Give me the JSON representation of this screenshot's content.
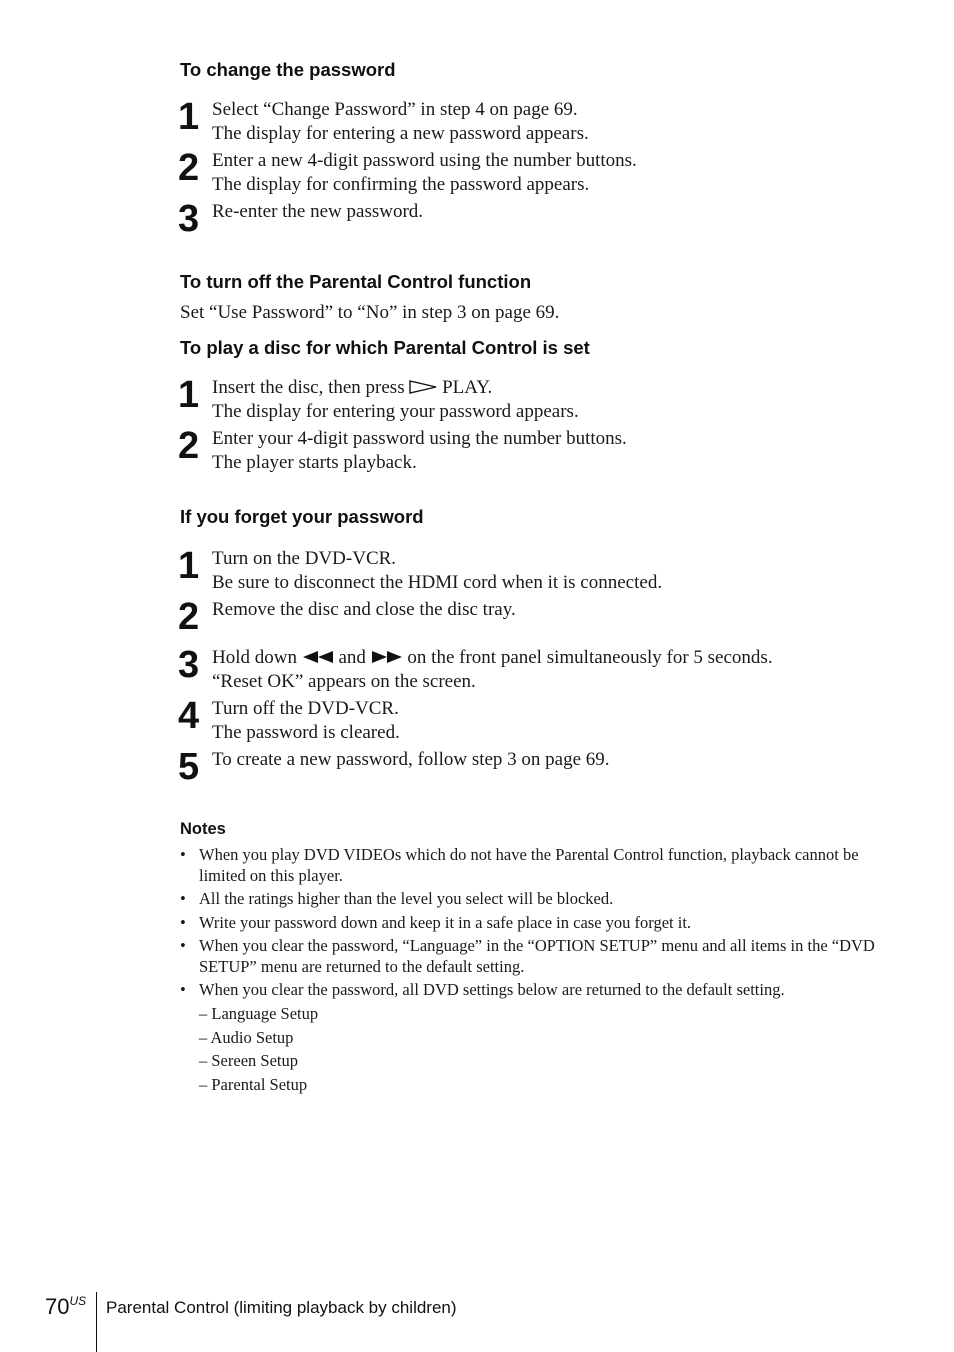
{
  "section_change": {
    "heading": "To change the password",
    "steps": [
      {
        "num": "1",
        "line1": "Select “Change Password” in step 4 on page 69.",
        "line2": "The display for entering a new password appears."
      },
      {
        "num": "2",
        "line1": "Enter a new 4-digit password using the number buttons.",
        "line2": "The display for confirming the password appears."
      },
      {
        "num": "3",
        "line1": "Re-enter the new password.",
        "line2": ""
      }
    ]
  },
  "section_turn_off": {
    "heading": "To turn off the Parental Control function",
    "text": "Set “Use Password” to “No” in step 3 on page 69."
  },
  "section_play": {
    "heading": "To play a disc for which Parental Control is set",
    "steps": [
      {
        "num": "1",
        "line1_pre": "Insert the disc, then press ",
        "icon": "play-icon",
        "line1_post": " PLAY.",
        "line2": "The display for entering your password appears."
      },
      {
        "num": "2",
        "line1": "Enter your 4-digit password using the number buttons.",
        "line2": "The player starts playback."
      }
    ]
  },
  "section_forget": {
    "heading": "If you forget your password",
    "steps": [
      {
        "num": "1",
        "line1": "Turn on the DVD-VCR.",
        "line2": "Be sure to disconnect the HDMI cord when it is connected."
      },
      {
        "num": "2",
        "line1": "Remove the disc and close the disc tray.",
        "line2": ""
      },
      {
        "num": "3",
        "line1_pre": "Hold down ",
        "icon_a": "rewind-icon",
        "line1_mid": " and ",
        "icon_b": "fast-forward-icon",
        "line1_post": " on the front panel simultaneously for 5 seconds.",
        "line2": "“Reset OK” appears on the screen."
      },
      {
        "num": "4",
        "line1": "Turn off the DVD-VCR.",
        "line2": "The password is cleared."
      },
      {
        "num": "5",
        "line1": "To create a new password, follow step 3 on page 69.",
        "line2": ""
      }
    ]
  },
  "notes": {
    "heading": "Notes",
    "bullet": "•",
    "items": [
      "When you play DVD VIDEOs which do not have the Parental Control function, playback cannot be limited on this player.",
      "All the ratings higher than the level you select will be blocked.",
      "Write your password down and keep it in a safe place in case you forget it.",
      "When you clear the password, “Language” in the “OPTION SETUP” menu and all items in the “DVD SETUP” menu are returned to the default setting.",
      "When you clear the password, all DVD settings below are returned to the default setting."
    ],
    "sub_items": [
      "– Language Setup",
      "– Audio Setup",
      "– Sereen Setup",
      "– Parental Setup"
    ]
  },
  "footer": {
    "page_number": "70",
    "page_suffix": "US",
    "section_title": "Parental Control (limiting playback by children)"
  }
}
